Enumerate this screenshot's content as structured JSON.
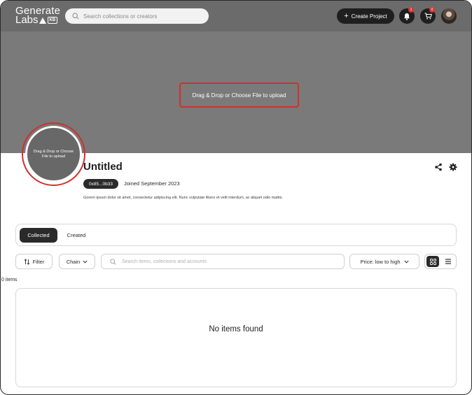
{
  "header": {
    "logo_line1": "Generate",
    "logo_line2": "Labs",
    "logo_badge": "KB",
    "search_placeholder": "Search collections or creators",
    "create_label": "Create Project",
    "notification_count": "1",
    "cart_count": "0"
  },
  "banner": {
    "upload_text": "Drag & Drop or Choose File to upload"
  },
  "profile": {
    "avatar_upload_text": "Drag & Drop or Choose File to upload",
    "name": "Untitled",
    "address": "0x85...0b33",
    "joined": "Joined September 2023",
    "bio": "Gorem ipsum dolor sit amet, consectetur adipiscing elit. Nunc vulputate libero et velit interdum, ac aliquet odio mattis."
  },
  "tabs": [
    {
      "label": "Collected",
      "active": true
    },
    {
      "label": "Created",
      "active": false
    }
  ],
  "filters": {
    "filter_label": "Filter",
    "chain_label": "Chain",
    "search_placeholder": "Search items, collections and accounts",
    "sort_label": "Price: low to high"
  },
  "results": {
    "count": "0 items",
    "empty_text": "No items found"
  },
  "colors": {
    "header_bg": "#6b6b6b",
    "banner_bg": "#7a7a7a",
    "highlight": "#d22f2f",
    "dark": "#1f1f1f"
  }
}
